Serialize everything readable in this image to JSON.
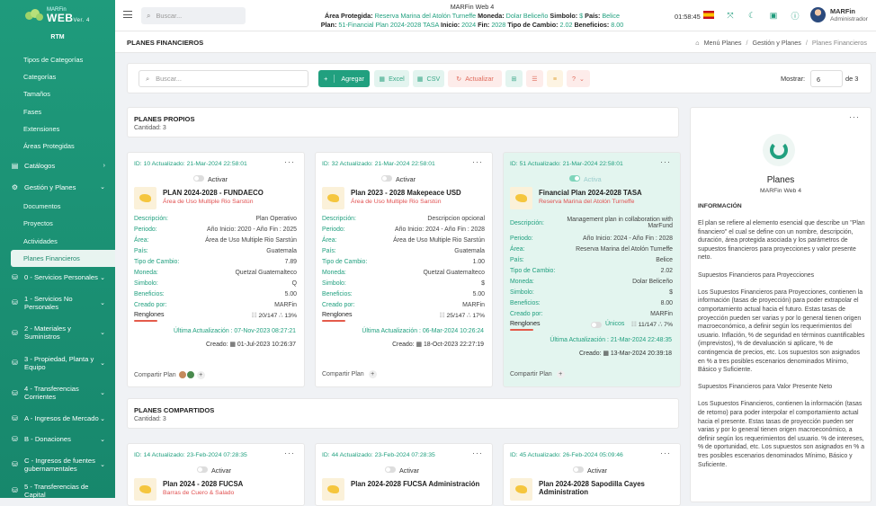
{
  "app": {
    "logo_small": "MARFin",
    "logo_big": "WEB",
    "logo_ver": "Ver. 4",
    "org": "RTM"
  },
  "sidebar": {
    "top_items": [
      "Tipos de Categorías",
      "Categorías",
      "Tamaños",
      "Fases",
      "Extensiones",
      "Áreas Protegidas"
    ],
    "catalogos": "Catálogos",
    "gestion": "Gestión y Planes",
    "gestion_items": [
      "Documentos",
      "Proyectos",
      "Actividades",
      "Planes Financieros"
    ],
    "groups": [
      "0 - Servicios Personales",
      "1 - Servicios No Personales",
      "2 - Materiales y Suministros",
      "3 - Propiedad, Planta y Equipo",
      "4 - Transferencias Corrientes",
      "A - Ingresos de Mercado",
      "B - Donaciones",
      "C - Ingresos de fuentes gubernamentales",
      "5 - Transferencias de Capital"
    ]
  },
  "topbar": {
    "search_placeholder": "Buscar...",
    "app_name": "MARFin Web 4",
    "l_area": "Área Protegida:",
    "area": "Reserva Marina del Atolón Turneffe",
    "l_moneda": "Moneda:",
    "moneda": "Dolar Beliceño",
    "l_simbolo": "Simbolo:",
    "simbolo": "$",
    "l_pais": "País:",
    "pais": "Belice",
    "l_plan": "Plan:",
    "plan": "51-Financial Plan 2024-2028 TASA",
    "l_inicio": "Inicio:",
    "inicio": "2024",
    "l_fin": "Fin:",
    "fin": "2028",
    "l_tc": "Tipo de Cambio:",
    "tc": "2.02",
    "l_ben": "Beneficios:",
    "ben": "8.00",
    "clock": "01:58:45",
    "user_name": "MARFin",
    "user_role": "Administrador"
  },
  "page": {
    "title": "PLANES FINANCIEROS",
    "crumbs": [
      "Menú Planes",
      "Gestión y Planes",
      "Planes Financieros"
    ]
  },
  "toolbar": {
    "search_placeholder": "Buscar...",
    "add": "Agregar",
    "excel": "Excel",
    "csv": "CSV",
    "refresh": "Actualizar",
    "help": "?",
    "mostrar": "Mostrar:",
    "per_page": "6",
    "of": "de  3"
  },
  "labels": {
    "activar": "Activar",
    "activa": "Activa",
    "descripcion": "Descripción:",
    "periodo": "Periodo:",
    "area": "Área:",
    "pais": "País:",
    "tipo_cambio": "Tipo de Cambio:",
    "moneda": "Moneda:",
    "simbolo": "Simbolo:",
    "beneficios": "Beneficios:",
    "creado_por": "Creado por:",
    "renglones": "Renglones",
    "unicos": "Únicos",
    "compartir": "Compartir Plan",
    "ult": "Última Actualización : ",
    "creado": "Creado: "
  },
  "sections": {
    "propios": {
      "title": "PLANES PROPIOS",
      "count": "Cantidad: 3"
    },
    "compartidos": {
      "title": "PLANES COMPARTIDOS",
      "count": "Cantidad: 3"
    }
  },
  "cards": [
    {
      "id": "ID: 10 Actualizado: 21-Mar-2024 22:58:01",
      "name": "PLAN 2024-2028 - FUNDAECO",
      "area_sub": "Área de Uso Multiple Rio Sarstún",
      "desc": "Plan Operativo",
      "periodo": "Año Inicio: 2020 - Año Fin : 2025",
      "area": "Área de Uso Multiple Rio Sarstún",
      "pais": "Guatemala",
      "tc": "7.89",
      "moneda": "Quetzal Guatemalteco",
      "simbolo": "Q",
      "beneficios": "5.00",
      "creado_por": "MARFin",
      "renglones": "20/147 ∴ 13%",
      "ult": "07-Nov-2023 08:27:21",
      "creado": "01-Jul-2023 10:26:37"
    },
    {
      "id": "ID: 32 Actualizado: 21-Mar-2024 22:58:01",
      "name": "Plan 2023 - 2028 Makepeace USD",
      "area_sub": "Área de Uso Multiple Rio Sarstún",
      "desc": "Descripcion opcional",
      "periodo": "Año Inicio: 2024 - Año Fin : 2028",
      "area": "Área de Uso Multiple Rio Sarstún",
      "pais": "Guatemala",
      "tc": "1.00",
      "moneda": "Quetzal Guatemalteco",
      "simbolo": "$",
      "beneficios": "5.00",
      "creado_por": "MARFin",
      "renglones": "25/147 ∴ 17%",
      "ult": "06-Mar-2024 10:26:24",
      "creado": "18-Oct-2023 22:27:19"
    },
    {
      "id": "ID: 51 Actualizado: 21-Mar-2024 22:58:01",
      "name": "Financial Plan 2024-2028 TASA",
      "area_sub": "Reserva Marina del Atolón Turneffe",
      "desc": "Management plan in collaboration with MarFund",
      "periodo": "Año Inicio: 2024 - Año Fin : 2028",
      "area": "Reserva Marina del Atolón Turneffe",
      "pais": "Belice",
      "tc": "2.02",
      "moneda": "Dolar Beliceño",
      "simbolo": "$",
      "beneficios": "8.00",
      "creado_por": "MARFin",
      "renglones": "11/147 ∴ 7%",
      "ult": "21-Mar-2024 22:48:35",
      "creado": "13-Mar-2024 20:39:18"
    }
  ],
  "shared_cards": [
    {
      "id": "ID: 14 Actualizado: 23-Feb-2024 07:28:35",
      "name": "Plan 2024 - 2028 FUCSA",
      "area_sub": "Barras de Cuero & Salado"
    },
    {
      "id": "ID: 44 Actualizado: 23-Feb-2024 07:28:35",
      "name": "Plan 2024-2028 FUCSA Administración",
      "area_sub": ""
    },
    {
      "id": "ID: 45 Actualizado: 26-Feb-2024 05:09:46",
      "name": "Plan 2024-2028 Sapodilla Cayes Administration",
      "area_sub": ""
    }
  ],
  "info": {
    "title": "Planes",
    "subtitle": "MARFin Web 4",
    "heading": "INFORMACIÓN",
    "text": "El plan se refiere al elemento esencial que describe un \"Plan financiero\" el cual se define con un nombre, descripción, duración, área protegida asociada y los parámetros de supuestos financieros para proyecciones y valor presente neto.\n\nSupuestos Financieros para Proyecciones\n\nLos Supuestos Financieros para Proyecciones, contienen la información (tasas de proyección) para poder extrapolar el comportamiento actual hacia el futuro. Estas tasas de proyección pueden ser varias y por lo general tienen origen macroeconómico, a definir según los requerimientos del usuario. Inflación, % de seguridad en términos cuantificables (imprevistos), % de devaluación si aplicare, % de contingencia de precios, etc. Los supuestos son asignados en % a tres posibles escenarios denominados Mínimo, Básico y Suficiente.\n\nSupuestos Financieros para Valor Presente Neto\n\nLos Supuestos Financieros, contienen la información (tasas de retorno) para poder interpolar el comportamiento actual hacia el presente. Estas tasas de proyección pueden ser varias y por lo general tienen origen macroeconómico, a definir según los requerimientos del usuario. % de intereses, % de oportunidad, etc. Los supuestos son asignados en % a tres posibles escenarios denominados Mínimo, Básico y Suficiente."
  }
}
